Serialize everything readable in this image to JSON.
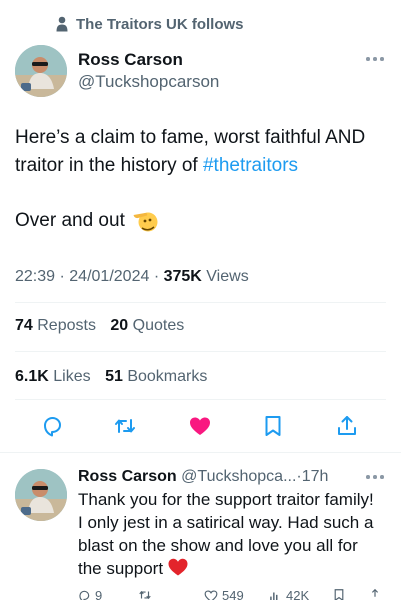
{
  "social_context": {
    "text": "The Traitors UK follows",
    "icon": "person-icon"
  },
  "tweet": {
    "author": {
      "display_name": "Ross Carson",
      "handle": "@Tuckshopcarson",
      "avatar": "avatar"
    },
    "text_before_hashtag": "Here’s a claim to fame, worst faithful AND traitor in the history of ",
    "hashtag": "#thetraitors",
    "second_line": "Over and out",
    "emoji": "saluting-face-icon",
    "time": "22:39",
    "separator": "·",
    "date": "24/01/2024",
    "views_count": "375K",
    "views_label": "Views",
    "reposts_count": "74",
    "reposts_label": "Reposts",
    "quotes_count": "20",
    "quotes_label": "Quotes",
    "likes_count": "6.1K",
    "likes_label": "Likes",
    "bookmarks_count": "51",
    "bookmarks_label": "Bookmarks",
    "liked": true
  },
  "actions": [
    "reply-icon",
    "retweet-icon",
    "like-icon",
    "bookmark-icon",
    "share-icon"
  ],
  "reply": {
    "display_name": "Ross Carson",
    "handle": "@Tuckshopca...",
    "separator": "·",
    "time": "17h",
    "text": "Thank you for the support traitor family! I only jest in a satirical way. Had such a blast on the show and love you all for the support",
    "emoji": "red-heart-icon",
    "reply_count": "9",
    "like_count": "549",
    "views_count": "42K"
  },
  "colors": {
    "text": "#0f1419",
    "secondary": "#536471",
    "link": "#1d9bf0",
    "like": "#f91880",
    "divider": "#eff3f4"
  }
}
